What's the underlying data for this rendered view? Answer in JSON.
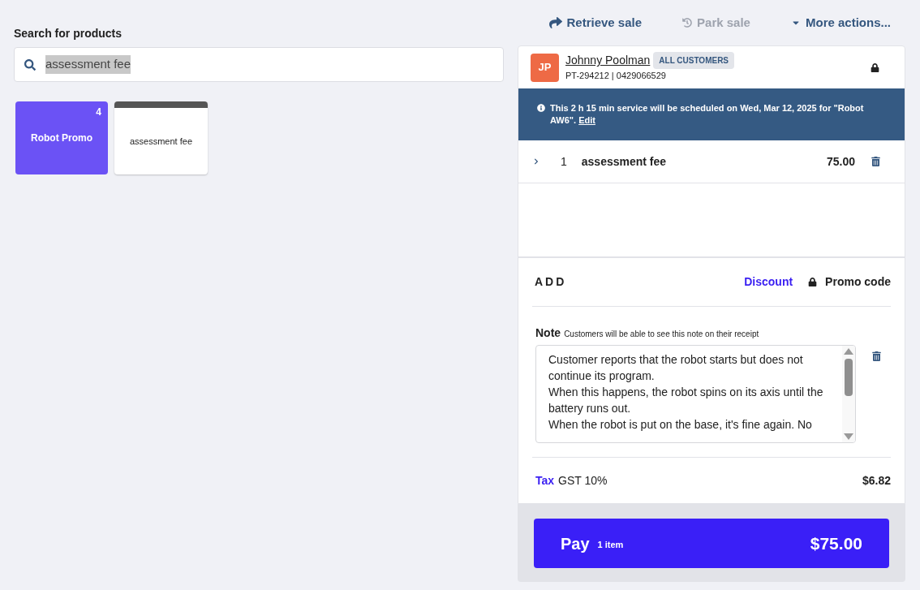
{
  "actions": [
    {
      "kind": "retrieve",
      "label": "Retrieve sale",
      "disabled": false
    },
    {
      "kind": "park",
      "label": "Park sale",
      "disabled": true
    },
    {
      "kind": "more",
      "label": "More actions...",
      "disabled": false
    }
  ],
  "search": {
    "label": "Search for products",
    "value": "assessment fee"
  },
  "products": [
    {
      "kind": "group",
      "name": "Robot Promo",
      "count": "4",
      "color": "#6b52f5"
    },
    {
      "kind": "item",
      "name": "assessment fee",
      "color": "#555555"
    }
  ],
  "customer": {
    "initials": "JP",
    "name": "Johnny Poolman",
    "group": "ALL CUSTOMERS",
    "details": "PT-294212 | 0429066529"
  },
  "banner": {
    "text": "This 2 h 15 min service will be scheduled on Wed, Mar 12, 2025 for \"Robot AW6\".",
    "link": "Edit"
  },
  "lines": [
    {
      "quantity": "1",
      "name": "assessment fee",
      "price": "75.00",
      "expanded": false
    }
  ],
  "add": {
    "title": "ADD",
    "discount": "Discount",
    "promo": "Promo code"
  },
  "note": {
    "label": "Note",
    "hint": "Customers will be able to see this note on their receipt",
    "value": "Customer reports that the robot starts but does not continue its program.\nWhen this happens, the robot spins on its axis until the battery runs out.\nWhen the robot is put on the base, it's fine again. No"
  },
  "tax": {
    "label": "Tax",
    "name": "GST 10%",
    "amount": "$6.82"
  },
  "pay": {
    "label": "Pay",
    "items": "1 item",
    "total": "$75.00"
  }
}
